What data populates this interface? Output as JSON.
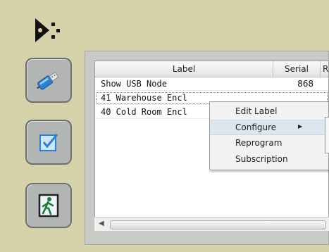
{
  "sidebar": {
    "buttons": [
      {
        "name": "usb-button",
        "icon": "usb-plug-icon"
      },
      {
        "name": "checklist-button",
        "icon": "checkbox-icon"
      },
      {
        "name": "exit-button",
        "icon": "exit-door-icon"
      }
    ]
  },
  "table": {
    "columns": [
      "Label",
      "Serial",
      "R"
    ],
    "rows": [
      {
        "label": "Show USB Node",
        "serial": "868"
      },
      {
        "label": "41 Warehouse Encl",
        "serial": ""
      },
      {
        "label": "40 Cold Room Encl",
        "serial": ""
      }
    ]
  },
  "context_menu": {
    "items": [
      "Edit Label",
      "Configure",
      "Reprogram",
      "Subscription"
    ],
    "highlighted": "Configure"
  },
  "colors": {
    "background": "#d6d3ab",
    "button_bg": "#b3b5b5",
    "menu_highlight": "#dde6ef"
  }
}
